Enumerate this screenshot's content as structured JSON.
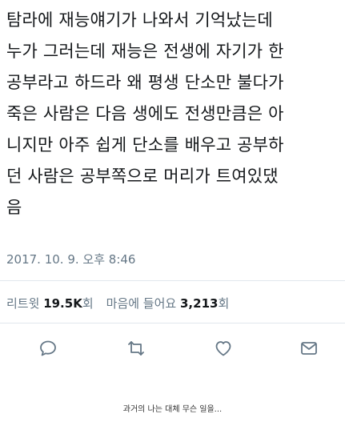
{
  "tweet": {
    "lines": [
      "탐라에 재능얘기가 나와서 기억났는데",
      "누가 그러는데 재능은 전생에 자기가 한",
      "공부라고 하드라 왜 평생 단소만 불다가",
      "죽은 사람은 다음 생에도 전생만큼은 아",
      "니지만 아주 쉽게 단소를 배우고 공부하",
      "던 사람은 공부쪽으로 머리가 트여있댔",
      "음"
    ],
    "timestamp": "2017. 10. 9. 오후 8:46"
  },
  "stats": {
    "retweet_label": "리트윗",
    "retweet_count": "19.5K",
    "retweet_unit": "회",
    "like_label": "마음에 들어요",
    "like_count": "3,213",
    "like_unit": "회"
  },
  "actions": {
    "reply_icon": "reply-icon",
    "retweet_icon": "retweet-icon",
    "like_icon": "heart-icon",
    "dm_icon": "mail-icon"
  },
  "colors": {
    "text": "#14171a",
    "muted": "#657786",
    "divider": "#e1e8ed",
    "icon": "#657786"
  },
  "caption": "과거의 나는 대체 무슨 일을..."
}
